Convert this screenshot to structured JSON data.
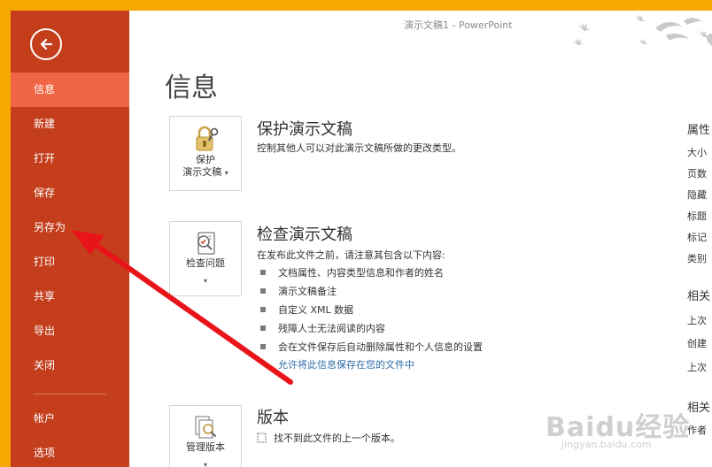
{
  "window": {
    "title": "演示文稿1 - PowerPoint"
  },
  "sidebar": {
    "items": [
      {
        "label": "信息",
        "active": true
      },
      {
        "label": "新建"
      },
      {
        "label": "打开"
      },
      {
        "label": "保存"
      },
      {
        "label": "另存为"
      },
      {
        "label": "打印"
      },
      {
        "label": "共享"
      },
      {
        "label": "导出"
      },
      {
        "label": "关闭"
      }
    ],
    "bottom_items": [
      {
        "label": "帐户"
      },
      {
        "label": "选项"
      }
    ]
  },
  "page": {
    "title": "信息"
  },
  "protect": {
    "button_line1": "保护",
    "button_line2": "演示文稿",
    "title": "保护演示文稿",
    "description": "控制其他人可以对此演示文稿所做的更改类型。"
  },
  "inspect": {
    "button_label": "检查问题",
    "title": "检查演示文稿",
    "description": "在发布此文件之前，请注意其包含以下内容:",
    "bullets": [
      "文档属性、内容类型信息和作者的姓名",
      "演示文稿备注",
      "自定义 XML 数据",
      "残障人士无法阅读的内容",
      "会在文件保存后自动删除属性和个人信息的设置"
    ],
    "link": "允许将此信息保存在您的文件中"
  },
  "versions": {
    "button_label": "管理版本",
    "title": "版本",
    "description": "找不到此文件的上一个版本。"
  },
  "properties": {
    "header": "属性",
    "rows": [
      "大小",
      "页数",
      "隐藏",
      "标题",
      "标记",
      "类别"
    ],
    "related_dates_header": "相关",
    "date_rows": [
      "上次",
      "创建",
      "上次"
    ],
    "related_people_header": "相关",
    "people_rows": [
      "作者"
    ]
  },
  "watermark": {
    "main": "Baidu经验",
    "sub": "jingyan.baidu.com"
  },
  "colors": {
    "accent": "#c43e1c",
    "active": "#f06543",
    "frame": "#f6a800",
    "annotation_arrow": "#e8141a"
  }
}
